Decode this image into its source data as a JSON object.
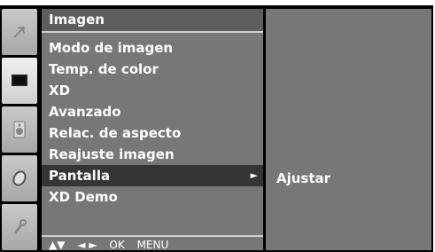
{
  "menu": {
    "title": "Imagen",
    "items": [
      {
        "label": "Modo de imagen"
      },
      {
        "label": "Temp. de color"
      },
      {
        "label": "XD"
      },
      {
        "label": "Avanzado"
      },
      {
        "label": "Relac. de aspecto"
      },
      {
        "label": "Reajuste imagen"
      },
      {
        "label": "Pantalla",
        "selected": true,
        "arrow": "►"
      },
      {
        "label": "XD Demo"
      }
    ],
    "nav_hint": {
      "updown": "▲▼",
      "leftright": "◄ ►",
      "ok": "OK",
      "menu": "MENU"
    }
  },
  "submenu": {
    "items": [
      {
        "label": "Ajustar"
      }
    ]
  },
  "rail": {
    "icons": [
      "satellite-dish-icon",
      "picture-screen-icon",
      "speaker-icon",
      "clock-icon",
      "wrench-icon"
    ],
    "active": "picture-screen-icon"
  },
  "colors": {
    "panel": "#777777",
    "title_bar": "#5e5e5e",
    "selected_row": "#353535",
    "text": "#ffffff"
  }
}
